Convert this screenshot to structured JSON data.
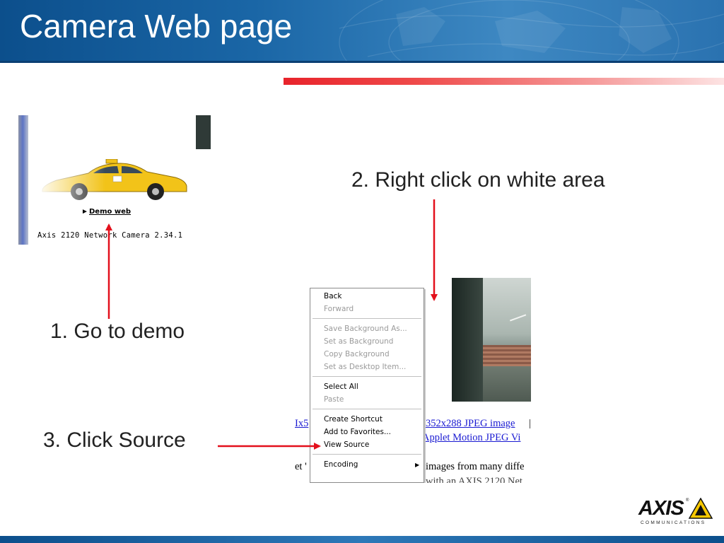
{
  "slide": {
    "title": "Camera Web page"
  },
  "screenshot_home": {
    "demo_arrow": "►",
    "demo_link": "Demo web",
    "camera_label": "Axis 2120 Network Camera 2.34.1"
  },
  "annotations": {
    "step1": "1. Go to demo",
    "step2": "2. Right click on white area",
    "step3": "3. Click Source"
  },
  "context_menu": {
    "items": [
      {
        "label": "Back",
        "enabled": true
      },
      {
        "label": "Forward",
        "enabled": false
      },
      {
        "label": "Save Background As...",
        "enabled": false
      },
      {
        "label": "Set as Background",
        "enabled": false
      },
      {
        "label": "Copy Background",
        "enabled": false
      },
      {
        "label": "Set as Desktop Item...",
        "enabled": false
      },
      {
        "label": "Select All",
        "enabled": true
      },
      {
        "label": "Paste",
        "enabled": false
      },
      {
        "label": "Create Shortcut",
        "enabled": true
      },
      {
        "label": "Add to Favorites...",
        "enabled": true
      },
      {
        "label": "View Source",
        "enabled": true
      },
      {
        "label": "Encoding",
        "enabled": true,
        "submenu": true
      }
    ],
    "submenu_arrow": "▶"
  },
  "background_page": {
    "link_left_1": "Ix5",
    "link_right_1": "352x288 JPEG image",
    "sep_1": "|",
    "link_right_2": "Applet Motion JPEG Vi",
    "text_left_1": "et '",
    "text_right_1": "images from many diffe",
    "text_right_2": "with an AXIS 2120 Net"
  },
  "logo": {
    "name": "AXIS",
    "reg": "®",
    "sub": "COMMUNICATIONS"
  },
  "colors": {
    "header_blue": "#1a66a6",
    "accent_red": "#e8232b",
    "arrow_red": "#e3101c",
    "link_blue": "#1a1ad2",
    "logo_yellow": "#f7c800"
  }
}
